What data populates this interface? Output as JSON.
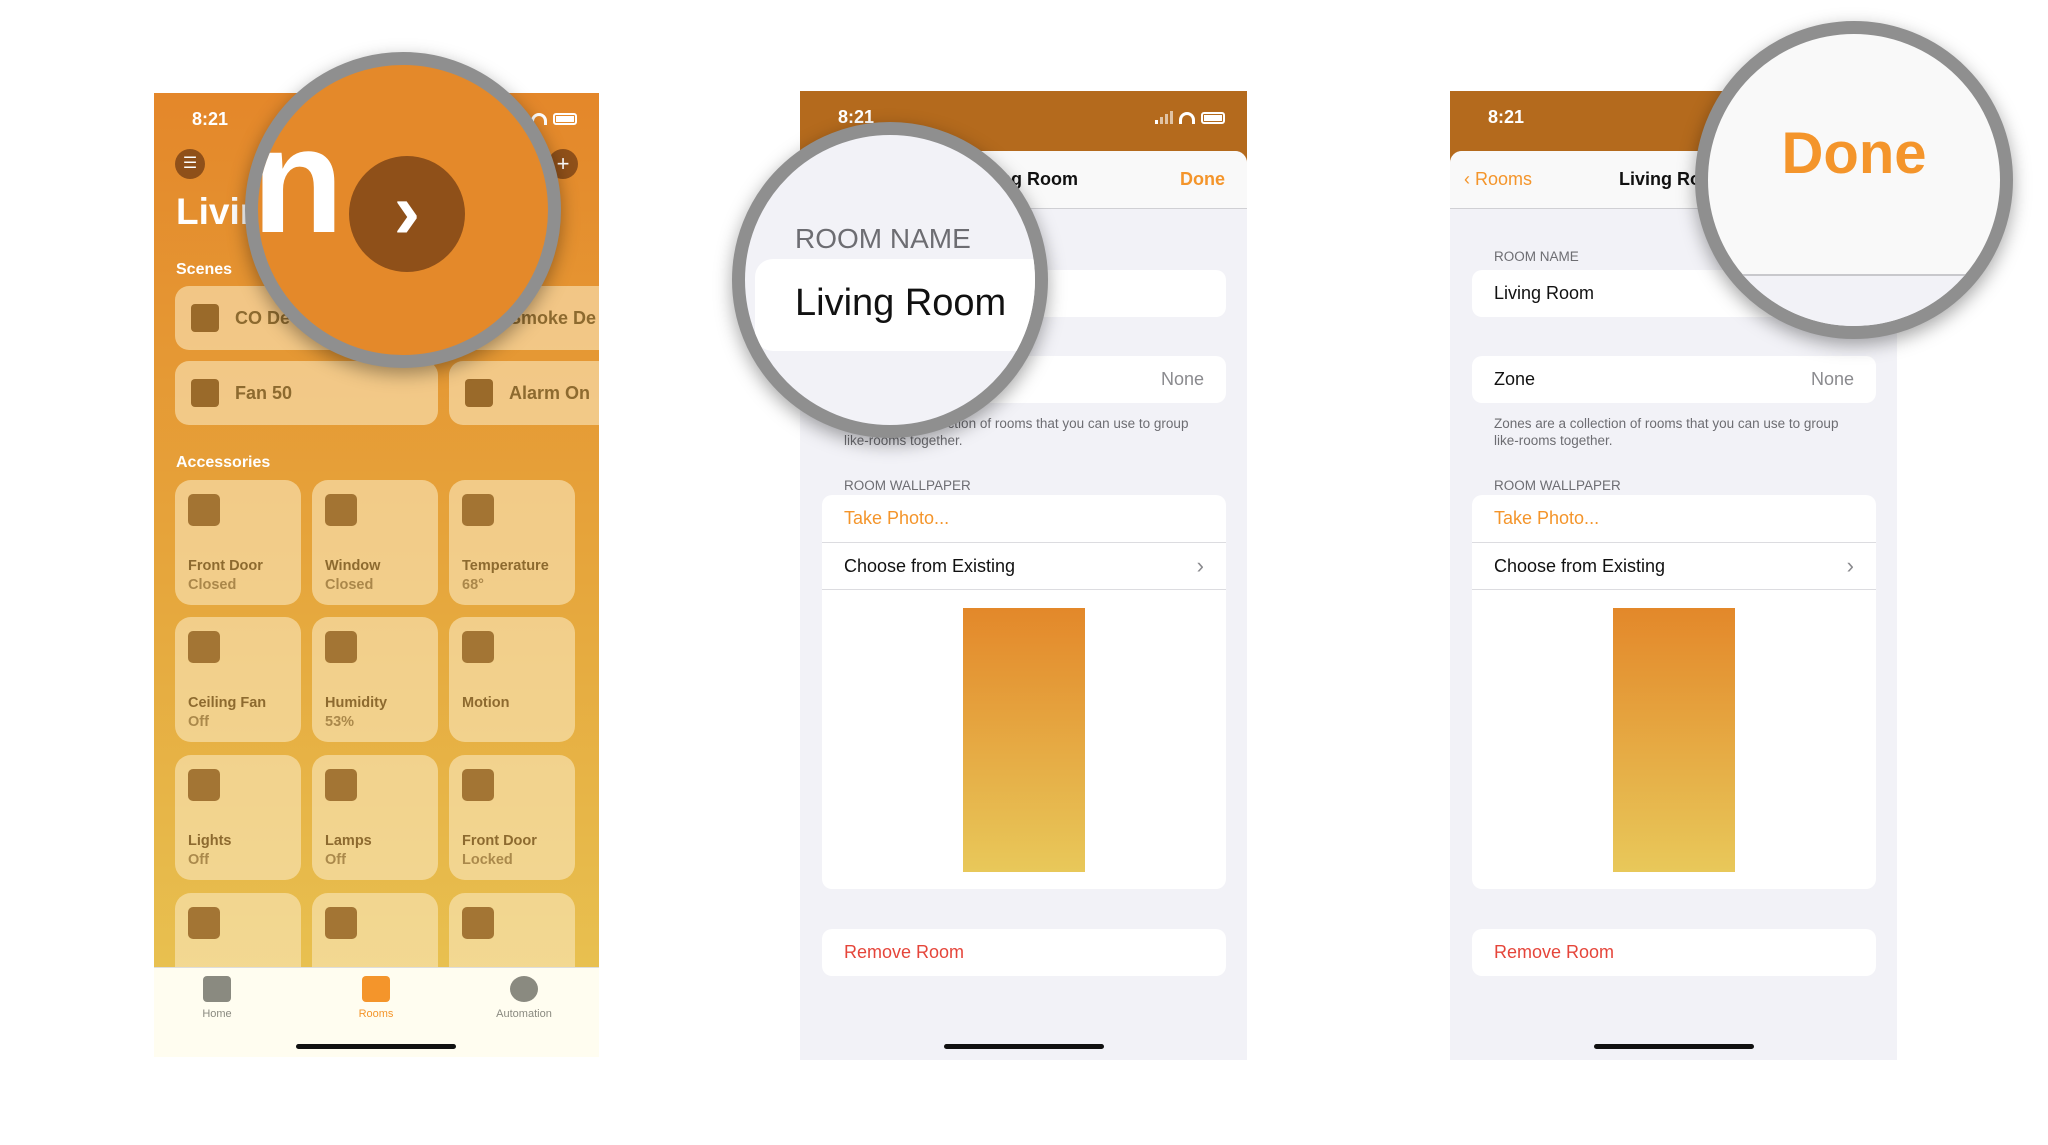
{
  "status": {
    "time": "8:21"
  },
  "screen1": {
    "title": "Livin",
    "scenes_label": "Scenes",
    "accessories_label": "Accessories",
    "scenes": [
      {
        "label": "CO De",
        "icon": "coffee-cup-icon"
      },
      {
        "label": "Smoke De",
        "icon": "smoke-icon"
      },
      {
        "label": "Fan 50",
        "icon": "chair-icon"
      },
      {
        "label": "Alarm On",
        "icon": "house-icon"
      }
    ],
    "accessories": [
      {
        "name": "Front Door",
        "state": "Closed",
        "icon": "door-icon"
      },
      {
        "name": "Window",
        "state": "Closed",
        "icon": "window-icon"
      },
      {
        "name": "Temperature",
        "state": "68°",
        "icon": "thermometer-icon"
      },
      {
        "name": "Ceiling Fan",
        "state": "Off",
        "icon": "ceiling-fan-icon"
      },
      {
        "name": "Humidity",
        "state": "53%",
        "icon": "humidity-icon"
      },
      {
        "name": "Motion",
        "state": "",
        "icon": "motion-icon"
      },
      {
        "name": "Lights",
        "state": "Off",
        "icon": "light-icon"
      },
      {
        "name": "Lamps",
        "state": "Off",
        "icon": "lamp-icon"
      },
      {
        "name": "Front Door",
        "state": "Locked",
        "icon": "lock-icon"
      },
      {
        "name": "",
        "state": "",
        "icon": "apple-tv-icon"
      },
      {
        "name": "",
        "state": "",
        "icon": "homepod-icon"
      },
      {
        "name": "",
        "state": "",
        "icon": "sprinkler-icon"
      }
    ],
    "tabs": [
      {
        "label": "Home"
      },
      {
        "label": "Rooms"
      },
      {
        "label": "Automation"
      }
    ],
    "magnifier": {
      "fragment": "n"
    }
  },
  "settings": {
    "title": "Living Room",
    "done": "Done",
    "back": "Rooms",
    "room_name_header": "ROOM NAME",
    "room_name": "Living Room",
    "zone_label": "Zone",
    "zone_value": "None",
    "zone_footnote": "Zones are a collection of rooms that you can use to group like-rooms together.",
    "wallpaper_header": "ROOM WALLPAPER",
    "take_photo": "Take Photo...",
    "choose_existing": "Choose from Existing",
    "remove_room": "Remove Room"
  },
  "colors": {
    "accent": "#f4952b",
    "danger": "#e5453a",
    "status_bar": "#b46a1d",
    "wallpaper_top": "#e3882a",
    "wallpaper_bottom": "#e8c85a"
  }
}
